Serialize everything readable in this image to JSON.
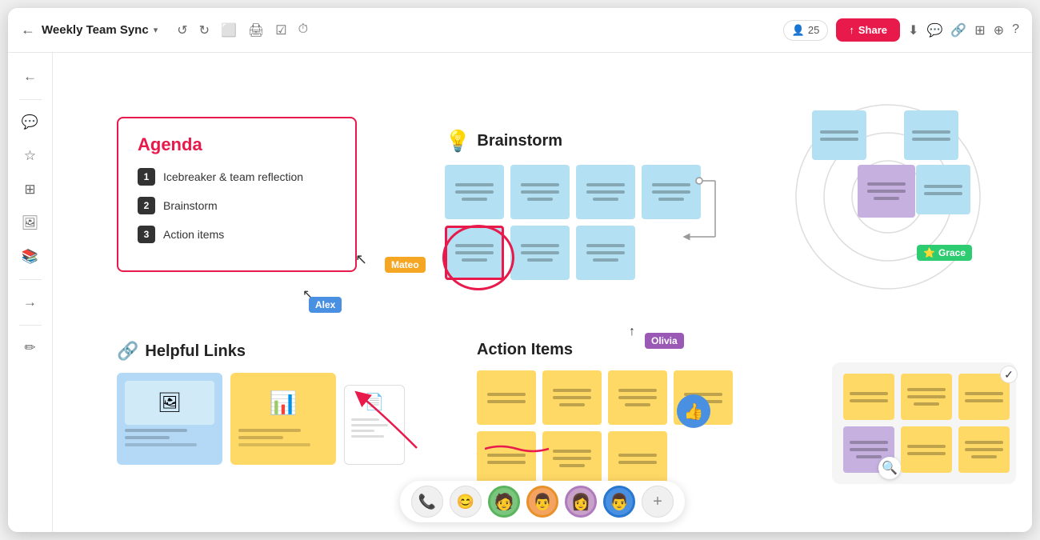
{
  "app": {
    "title": "Weekly Team Sync",
    "title_dropdown": "▾",
    "share_label": "Share",
    "user_count": "25",
    "share_icon": "↑"
  },
  "toolbar": {
    "icons": [
      "↩",
      "↪",
      "⬜",
      "🖨",
      "☑",
      "⏱"
    ]
  },
  "topbar_right_icons": [
    "⬇",
    "💬",
    "🔗",
    "⊞",
    "⊕",
    "?"
  ],
  "sidebar": {
    "items": [
      {
        "icon": "←",
        "name": "back"
      },
      {
        "icon": "💬",
        "name": "comments"
      },
      {
        "icon": "☆",
        "name": "star"
      },
      {
        "icon": "⊞",
        "name": "grid"
      },
      {
        "icon": "🖼",
        "name": "image"
      },
      {
        "icon": "📚",
        "name": "library"
      },
      {
        "icon": "→",
        "name": "export"
      },
      {
        "icon": "✏",
        "name": "pen"
      }
    ]
  },
  "agenda": {
    "title": "Agenda",
    "items": [
      {
        "num": "1",
        "text": "Icebreaker & team reflection"
      },
      {
        "num": "2",
        "text": "Brainstorm"
      },
      {
        "num": "3",
        "text": "Action items"
      }
    ]
  },
  "cursors": {
    "mateo": "Mateo",
    "alex": "Alex",
    "olivia": "Olivia",
    "grace": "Grace"
  },
  "brainstorm": {
    "title": "Brainstorm",
    "icon": "💡"
  },
  "helpful_links": {
    "title": "Helpful Links",
    "icon": "🔗"
  },
  "action_items": {
    "title": "Action Items"
  },
  "bottom_bar": {
    "phone_icon": "📞",
    "emoji_icon": "😊",
    "add_icon": "+"
  }
}
